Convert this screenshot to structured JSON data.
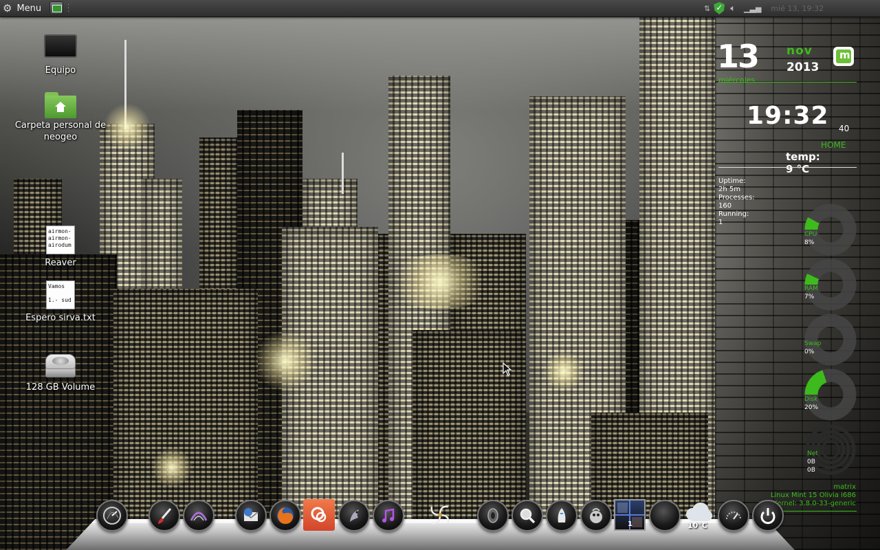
{
  "panel": {
    "menu_label": "Menu",
    "clock_text": "mié 13, 19:32"
  },
  "desktop_icons": [
    {
      "label": "Equipo",
      "icon": "computer-icon"
    },
    {
      "label": "Carpeta personal de neogeo",
      "icon": "home-folder-icon"
    },
    {
      "label": "Reaver",
      "icon": "text-file-icon",
      "preview": "airmon-\nairmon-\nairodum"
    },
    {
      "label": "Espero sirva.txt",
      "icon": "text-file-icon",
      "preview": "Vamos \n\n1.- sud"
    },
    {
      "label": "128 GB Volume",
      "icon": "drive-icon"
    }
  ],
  "conky": {
    "day": "13",
    "month": "nov",
    "year": "2013",
    "weekday": "miércoles",
    "time": "19:32",
    "seconds": "40",
    "location": "HOME",
    "temp": "temp: 9 °C",
    "uptime": "Uptime: 2h 5m",
    "processes": "Processes: 160",
    "running": "Running: 1",
    "meters": [
      {
        "name": "CPU",
        "value": "8%",
        "fraction": 0.08
      },
      {
        "name": "RAM",
        "value": "7%",
        "fraction": 0.07
      },
      {
        "name": "Swap",
        "value": "0%",
        "fraction": 0.0
      },
      {
        "name": "Disk",
        "value": "20%",
        "fraction": 0.2
      }
    ],
    "net": {
      "name": "Net",
      "down": "0B",
      "up": "0B"
    },
    "hostname": "matrix",
    "distro": "Linux Mint 15 Olivia i686",
    "kernel": "Kernel: 3.8.0-33-generic"
  },
  "dock": {
    "weather_temp": "10°C",
    "workspace_number": "1",
    "items": [
      "clock-icon",
      "paint-brush-icon",
      "inkscape-icon",
      "thunderbird-icon",
      "firefox-icon",
      "software-center-icon",
      "pidgin-icon",
      "music-icon",
      "mint-swirl-icon",
      "speaker-icon",
      "search-icon",
      "bird-icon",
      "gimp-icon",
      "workspace-switcher-icon",
      "blank-orb-icon",
      "weather-icon",
      "gauge-icon",
      "power-icon"
    ]
  },
  "colors": {
    "accent_green": "#3dbb1d",
    "conky_white": "#ffffff"
  }
}
